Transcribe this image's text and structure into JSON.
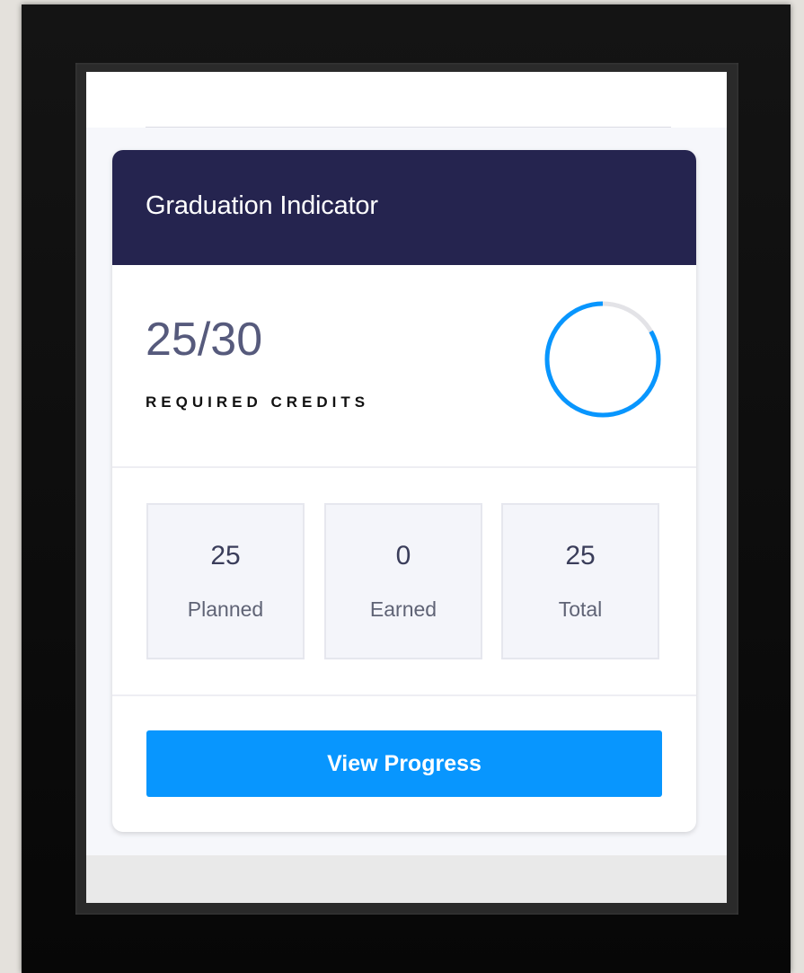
{
  "card": {
    "title": "Graduation Indicator",
    "credits": "25/30",
    "credits_label": "REQUIRED CREDITS",
    "progress": {
      "earned": 25,
      "required": 30,
      "fraction": 0.8333,
      "color": "#0896fe",
      "track_color": "#e3e3e7"
    }
  },
  "stats": [
    {
      "value": "25",
      "label": "Planned"
    },
    {
      "value": "0",
      "label": "Earned"
    },
    {
      "value": "25",
      "label": "Total"
    }
  ],
  "actions": {
    "view_progress": "View Progress"
  },
  "colors": {
    "header": "#25244f",
    "button": "#0896fe",
    "panel": "#f6f7fb"
  }
}
